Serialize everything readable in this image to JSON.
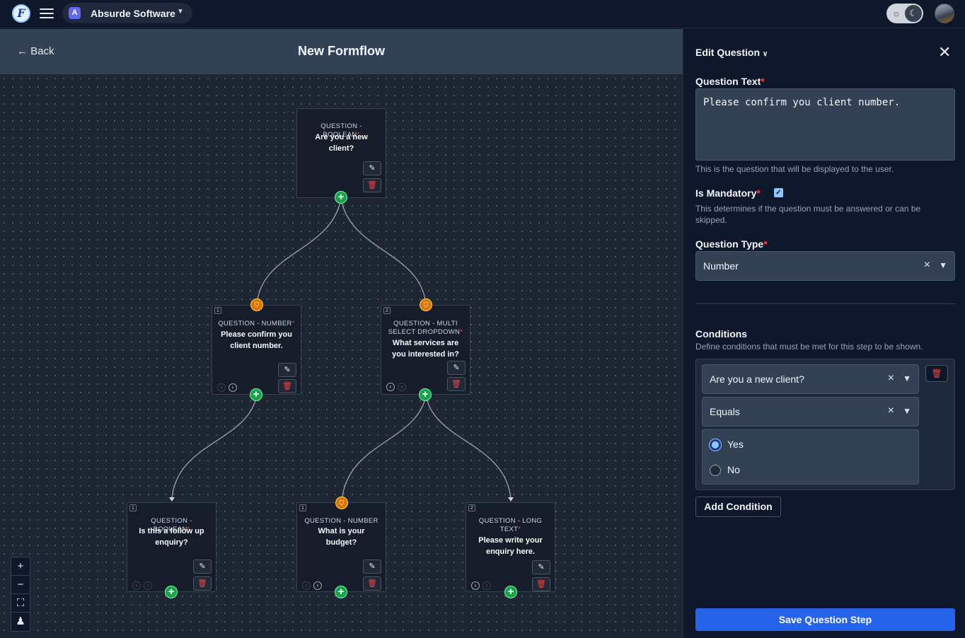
{
  "topbar": {
    "logo_letter": "F",
    "org_name": "Absurde Software",
    "org_icon_letter": "A"
  },
  "canvas": {
    "back_label": "Back",
    "title": "New Formflow",
    "zoom_in": "+",
    "zoom_out": "−",
    "fit_view": "⛶",
    "auto_layout": "♟"
  },
  "nodes": [
    {
      "id": "n0",
      "index": "",
      "type": "QUESTION - BOOLEAN",
      "required": true,
      "question": "Are you a new client?"
    },
    {
      "id": "n1",
      "index": "1",
      "type": "QUESTION - NUMBER",
      "required": true,
      "question": "Please confirm you client number."
    },
    {
      "id": "n2",
      "index": "2",
      "type": "QUESTION - MULTI SELECT DROPDOWN",
      "required": true,
      "question": "What services are you interested in?"
    },
    {
      "id": "n3",
      "index": "1",
      "type": "QUESTION - BOOLEAN",
      "required": true,
      "question": "Is this a follow up enquiry?"
    },
    {
      "id": "n4",
      "index": "1",
      "type": "QUESTION - NUMBER",
      "required": false,
      "question": "What is your budget?"
    },
    {
      "id": "n5",
      "index": "2",
      "type": "QUESTION - LONG TEXT",
      "required": true,
      "question": "Please write your enquiry here."
    }
  ],
  "panel": {
    "title": "Edit Question",
    "question_text_label": "Question Text",
    "question_text_value": "Please confirm you client number.",
    "question_text_help": "This is the question that will be displayed to the user.",
    "mandatory_label": "Is Mandatory",
    "mandatory_checked": true,
    "mandatory_help": "This determines if the question must be answered or can be skipped.",
    "question_type_label": "Question Type",
    "question_type_value": "Number",
    "conditions_label": "Conditions",
    "conditions_help": "Define conditions that must be met for this step to be shown.",
    "condition": {
      "question": "Are you a new client?",
      "operator": "Equals",
      "options": [
        {
          "label": "Yes",
          "selected": true
        },
        {
          "label": "No",
          "selected": false
        }
      ]
    },
    "add_condition_label": "Add Condition",
    "save_label": "Save Question Step"
  },
  "colors": {
    "accent": "#2563eb",
    "add_green": "#16a34a",
    "condition_amber": "#d97706",
    "required_red": "#ef4444"
  }
}
